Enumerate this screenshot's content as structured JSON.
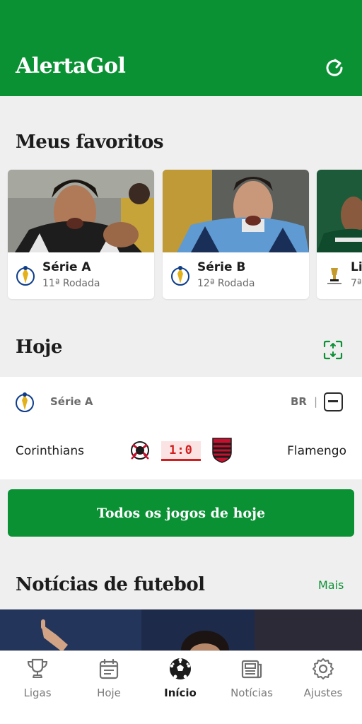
{
  "app": {
    "title": "AlertaGol"
  },
  "favorites": {
    "title": "Meus favoritos",
    "cards": [
      {
        "league": "Série A",
        "round": "11ª Rodada"
      },
      {
        "league": "Série B",
        "round": "12ª Rodada"
      },
      {
        "league": "Li",
        "round": "7ª"
      }
    ]
  },
  "today": {
    "title": "Hoje",
    "match": {
      "league": "Série A",
      "country": "BR",
      "separator": "|",
      "home_team": "Corinthians",
      "away_team": "Flamengo",
      "score": "1:0"
    },
    "all_games_label": "Todos os jogos de hoje"
  },
  "news": {
    "title": "Notícias de futebol",
    "more_label": "Mais"
  },
  "nav": {
    "items": [
      {
        "label": "Ligas",
        "icon": "trophy-icon"
      },
      {
        "label": "Hoje",
        "icon": "calendar-icon"
      },
      {
        "label": "Início",
        "icon": "soccer-ball-icon"
      },
      {
        "label": "Notícias",
        "icon": "newspaper-icon"
      },
      {
        "label": "Ajustes",
        "icon": "gear-icon"
      }
    ],
    "active": "Início"
  },
  "colors": {
    "brand": "#0a9134",
    "score": "#d11e1e"
  }
}
